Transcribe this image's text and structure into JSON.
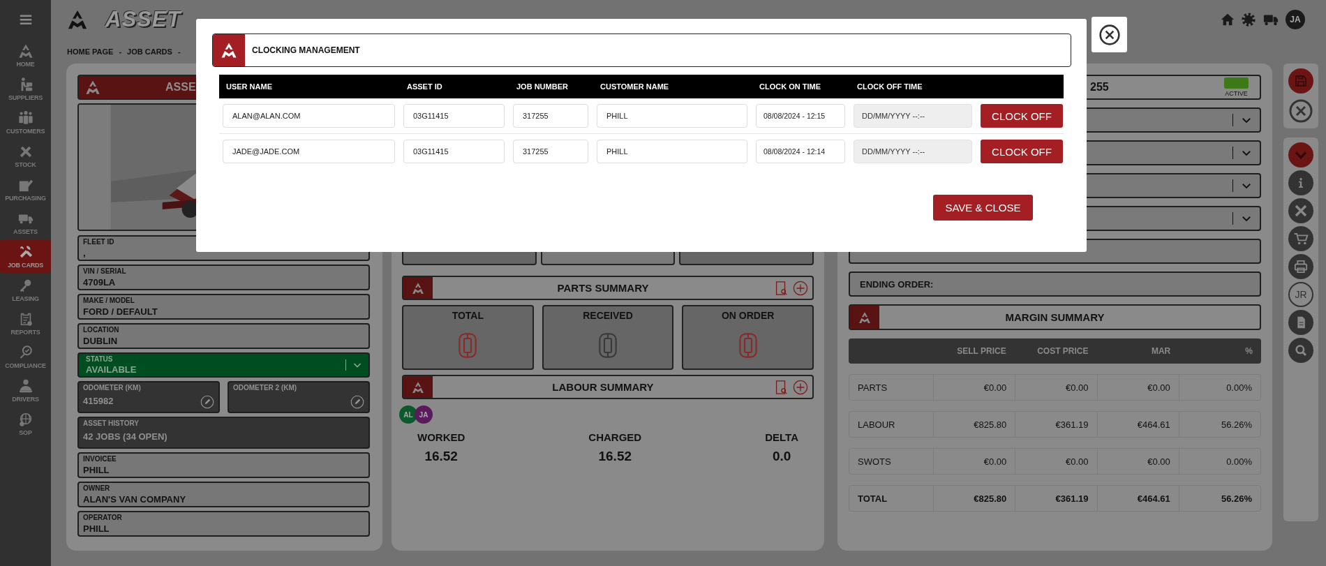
{
  "sidebar": {
    "items": [
      {
        "label": "HOME",
        "selected": false
      },
      {
        "label": "SUPPLIERS",
        "selected": false
      },
      {
        "label": "CUSTOMERS",
        "selected": false
      },
      {
        "label": "STOCK",
        "selected": false
      },
      {
        "label": "PURCHASING",
        "selected": false
      },
      {
        "label": "ASSETS",
        "selected": false
      },
      {
        "label": "JOB CARDS",
        "selected": true
      },
      {
        "label": "LEASING",
        "selected": false
      },
      {
        "label": "REPORTS",
        "selected": false
      },
      {
        "label": "COMPLIANCE",
        "selected": false
      },
      {
        "label": "DRIVERS",
        "selected": false
      },
      {
        "label": "SOP",
        "selected": false
      }
    ]
  },
  "header": {
    "logo_text": "ASSET",
    "user_initials": "JA"
  },
  "breadcrumb": {
    "items": [
      "HOME PAGE",
      "JOB CARDS"
    ],
    "separator": "-"
  },
  "asset_panel": {
    "title": "ASSE",
    "fields": [
      {
        "kind": "plain",
        "label": "FLEET ID",
        "value": ","
      },
      {
        "kind": "plain",
        "label": "VIN / SERIAL",
        "value": "4709LA"
      },
      {
        "kind": "plain",
        "label": "MAKE / MODEL",
        "value": "FORD / DEFAULT"
      },
      {
        "kind": "plain",
        "label": "LOCATION",
        "value": "DUBLIN"
      },
      {
        "kind": "status",
        "label": "STATUS",
        "value": "AVAILABLE"
      },
      {
        "kind": "pair",
        "items": [
          {
            "label": "ODOMETER (KM)",
            "value": "415982"
          },
          {
            "label": "ODOMETER 2 (KM)"
          }
        ]
      },
      {
        "kind": "dark",
        "label": "ASSET HISTORY",
        "value": "42 JOBS (34 OPEN)"
      },
      {
        "kind": "plain",
        "label": "INVOICEE",
        "value": "PHILL"
      },
      {
        "kind": "plain",
        "label": "OWNER",
        "value": "ALAN'S VAN COMPANY"
      },
      {
        "kind": "plain",
        "label": "OPERATOR",
        "value": "PHILL"
      }
    ]
  },
  "job_panel": {
    "parts_summary": {
      "title": "PARTS SUMMARY",
      "boxes": [
        {
          "label": "TOTAL",
          "color": "#8a2a2a"
        },
        {
          "label": "RECEIVED",
          "color": "#3a3a3a"
        },
        {
          "label": "ON ORDER",
          "color": "#8a2a2a"
        }
      ]
    },
    "labour_summary": {
      "title": "LABOUR SUMMARY",
      "workers": [
        {
          "initials": "AL",
          "color": "#0a5a2c"
        },
        {
          "initials": "JA",
          "color": "#5a1a5c"
        }
      ],
      "stats": [
        {
          "label": "WORKED",
          "value": "16.52"
        },
        {
          "label": "CHARGED",
          "value": "16.52"
        },
        {
          "label": "DELTA",
          "value": "0.0"
        }
      ]
    }
  },
  "job_card": {
    "number": "255",
    "status": "ACTIVE"
  },
  "ending_order": {
    "label": "ENDING ORDER:"
  },
  "margin_summary": {
    "title": "MARGIN SUMMARY",
    "columns": [
      "SELL PRICE",
      "COST PRICE",
      "MAR",
      "%"
    ],
    "rows": [
      {
        "kind": "normal",
        "label": "PARTS",
        "cells": [
          "€0.00",
          "€0.00",
          "€0.00",
          "0.00%"
        ]
      },
      {
        "kind": "normal",
        "label": "LABOUR",
        "cells": [
          "€825.80",
          "€361.19",
          "€464.61",
          "56.26%"
        ]
      },
      {
        "kind": "normal",
        "label": "SWOTS",
        "cells": [
          "€0.00",
          "€0.00",
          "€0.00",
          "0.00%"
        ]
      },
      {
        "kind": "total",
        "label": "TOTAL",
        "cells": [
          "€825.80",
          "€361.19",
          "€464.61",
          "56.26%"
        ]
      }
    ]
  },
  "toolbar": {
    "job_search_label": "JR"
  },
  "modal": {
    "title": "CLOCKING MANAGEMENT",
    "columns": [
      "USER NAME",
      "ASSET ID",
      "JOB NUMBER",
      "CUSTOMER NAME",
      "CLOCK ON TIME",
      "CLOCK OFF TIME"
    ],
    "rows": [
      {
        "user": "ALAN@ALAN.COM",
        "asset_id": "03G11415",
        "job_number": "317255",
        "customer": "PHILL",
        "clock_on": "08/08/2024 - 12:15",
        "clock_off": {
          "placeholder": "DD/MM/YYYY --:--",
          "disabled": true
        },
        "button": "CLOCK OFF"
      },
      {
        "user": "JADE@JADE.COM",
        "asset_id": "03G11415",
        "job_number": "317255",
        "customer": "PHILL",
        "clock_on": "08/08/2024 - 12:14",
        "clock_off": {
          "placeholder": "DD/MM/YYYY --:--",
          "disabled": true
        },
        "button": "CLOCK OFF"
      }
    ],
    "save_button": "SAVE & CLOSE"
  }
}
